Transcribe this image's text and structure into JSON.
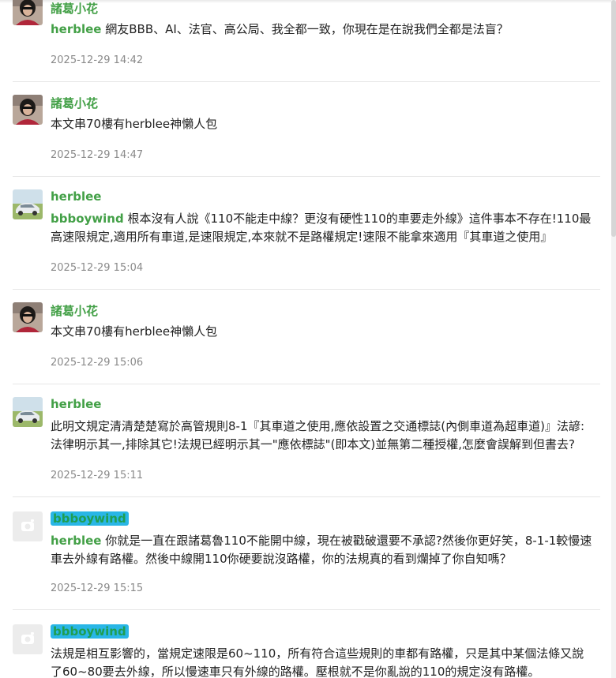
{
  "comments": [
    {
      "author": "諸葛小花",
      "mention": "herblee",
      "text": " 網友BBB、AI、法官、高公局、我全都一致，你現在是在說我們全都是法盲？",
      "time": "2025-12-29 14:42"
    },
    {
      "author": "諸葛小花",
      "mention": "",
      "text": "本文串70樓有herblee神懶人包",
      "time": "2025-12-29 14:47"
    },
    {
      "author": "herblee",
      "mention": "bbboywind",
      "text": " 根本沒有人說《110不能走中線？更沒有硬性110的車要走外線》這件事本不存在!110最高速限規定,適用所有車道,是速限規定,本來就不是路權規定!速限不能拿來適用『其車道之使用』",
      "time": "2025-12-29 15:04"
    },
    {
      "author": "諸葛小花",
      "mention": "",
      "text": "本文串70樓有herblee神懶人包",
      "time": "2025-12-29 15:06"
    },
    {
      "author": "herblee",
      "mention": "",
      "text": "此明文規定清清楚楚寫於高管規則8-1『其車道之使用,應依設置之交通標誌(內側車道為超車道)』法諺:法律明示其一,排除其它!法規已經明示其一\"應依標誌\"(即本文)並無第二種授權,怎麼會誤解到但書去?",
      "time": "2025-12-29 15:11"
    },
    {
      "author": "bbboywind",
      "mention": "herblee",
      "text": " 你就是一直在跟諸葛魯110不能開中線，現在被戳破還要不承認?然後你更好笑，8-1-1較慢速車去外線有路權。然後中線開110你硬要說沒路權，你的法規真的看到爛掉了你自知嗎？",
      "time": "2025-12-29 15:15"
    },
    {
      "author": "bbboywind",
      "mention": "",
      "text": "法規是相互影響的，當規定速限是60~110，所有符合這些規則的車都有路權，只是其中某個法條又說了60~80要去外線，所以慢速車只有外線的路權。壓根就不是你亂說的110的規定沒有路權。",
      "time": ""
    }
  ],
  "colors": {
    "author": "#43a047",
    "timestamp": "#8a8a8a",
    "highlight": "#29b6e6"
  },
  "icons": {
    "default_avatar": "camera-icon"
  }
}
